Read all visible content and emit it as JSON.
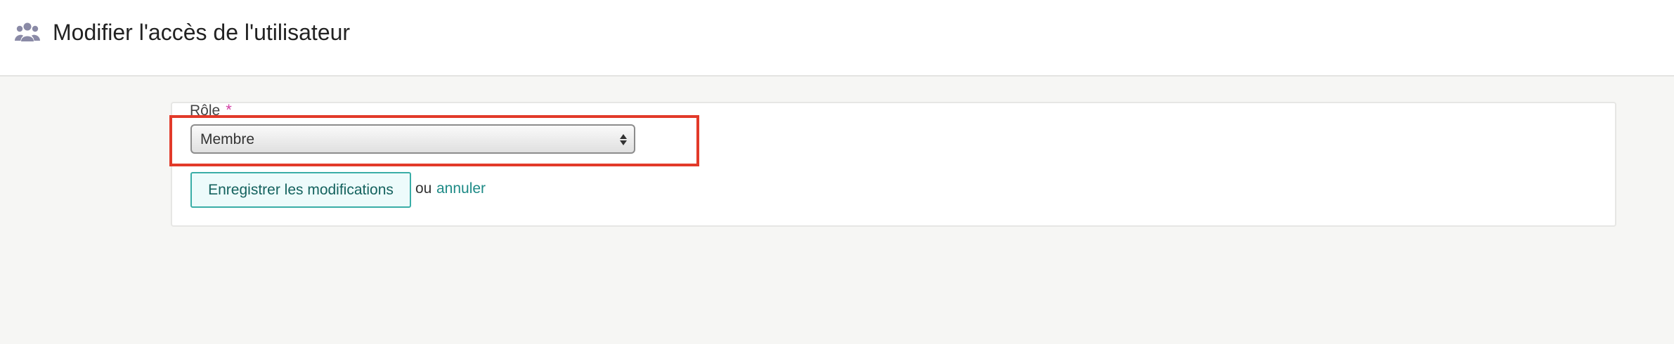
{
  "header": {
    "icon": "users-group-icon",
    "title": "Modifier l'accès de l'utilisateur"
  },
  "form": {
    "role_field": {
      "label": "Rôle",
      "required_marker": "*",
      "selected_value": "Membre"
    },
    "save_button_label": "Enregistrer les modifications",
    "or_text": "ou",
    "cancel_label": "annuler"
  },
  "colors": {
    "accent": "#1d8a86",
    "required": "#d23fa4",
    "highlight": "#e23a2a"
  }
}
